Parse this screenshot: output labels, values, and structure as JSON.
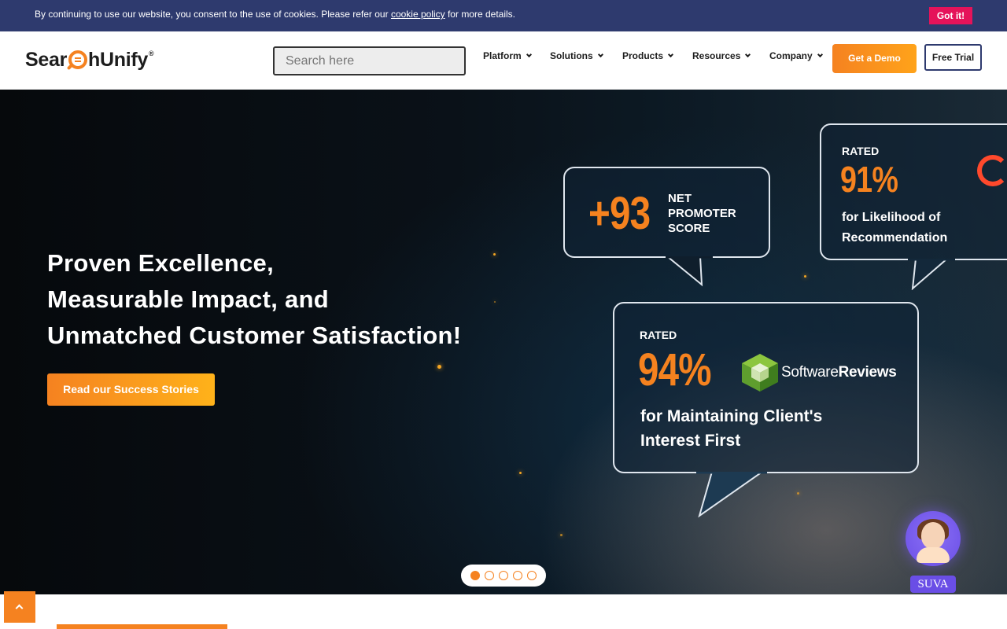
{
  "cookie_bar": {
    "text_before": "By continuing to use our website, you consent to the use of cookies. Please refer our ",
    "link_text": "cookie policy",
    "text_after": " for more details.",
    "button_label": "Got it!"
  },
  "header": {
    "logo_part1": "Sear",
    "logo_part2": "hUnify",
    "logo_tm": "®",
    "search_placeholder": "Search here",
    "nav": [
      "Platform",
      "Solutions",
      "Products",
      "Resources",
      "Company"
    ],
    "demo_label": "Get a Demo",
    "trial_label": "Free Trial"
  },
  "hero": {
    "title_line1": "Proven Excellence,",
    "title_line2": "Measurable Impact, and",
    "title_line3": "Unmatched Customer Satisfaction!",
    "cta_label": "Read our Success Stories",
    "nps": {
      "value": "+93",
      "label_line1": "NET",
      "label_line2": "PROMOTER",
      "label_line3": "SCORE"
    },
    "g2": {
      "rated": "RATED",
      "value": "91%",
      "text_line1": "for Likelihood of",
      "text_line2": "Recommendation"
    },
    "software_reviews": {
      "rated": "RATED",
      "value": "94%",
      "brand_part1": "Software",
      "brand_part2": "Reviews",
      "text_line1": "for Maintaining Client's",
      "text_line2": "Interest First"
    }
  },
  "carousel": {
    "slides": 5,
    "active_index": 0
  },
  "chat_widget": {
    "label": "SUVA"
  },
  "colors": {
    "accent": "#f58220",
    "cookie_bar": "#2e3a6e",
    "cookie_button": "#e5135a",
    "suva": "#6a4ee6"
  },
  "icons": [
    "chevron-down-icon",
    "arrow-up-icon",
    "g2-logo-icon",
    "software-reviews-cube-icon",
    "suva-avatar-icon"
  ]
}
